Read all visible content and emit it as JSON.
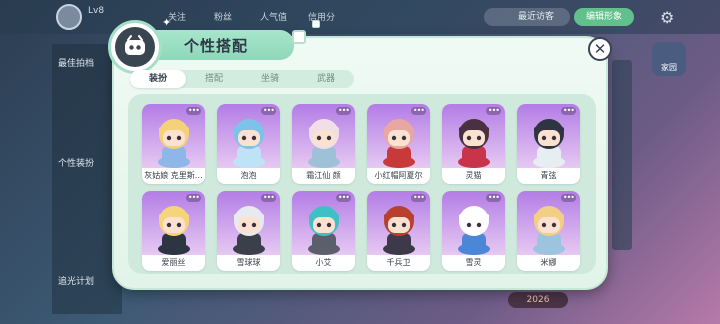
{
  "background": {
    "level": "Lv8",
    "tabs": [
      "关注",
      "粉丝",
      "人气值",
      "信用分"
    ],
    "recent_visitors": "最近访客",
    "edit_home": "编辑形象",
    "home_label": "家园",
    "left_labels": [
      "最佳拍档",
      "个性装扮",
      "追光计划"
    ],
    "badge_value": "2026"
  },
  "dialog": {
    "title": "个性搭配",
    "close_icon": "close-icon",
    "tabs": [
      {
        "label": "装扮",
        "active": true
      },
      {
        "label": "搭配",
        "active": false
      },
      {
        "label": "坐骑",
        "active": false
      },
      {
        "label": "武器",
        "active": false
      }
    ],
    "more_glyph": "•••",
    "outfits": [
      {
        "name": "灰姑娘 克里斯…",
        "hair": "#f3d27a",
        "outfit": "#8fb6e8",
        "skin": "#fbe1cf"
      },
      {
        "name": "泡泡",
        "hair": "#7cc3e8",
        "outfit": "#bfe3f6",
        "skin": "#fbe1cf"
      },
      {
        "name": "霜江仙 颜",
        "hair": "#f1dfe8",
        "outfit": "#9fc1d8",
        "skin": "#fbe1cf"
      },
      {
        "name": "小红帽阿夏尔",
        "hair": "#e8a7a2",
        "outfit": "#c83a3a",
        "skin": "#fbe1cf"
      },
      {
        "name": "灵猫",
        "hair": "#4a3140",
        "outfit": "#c8354a",
        "skin": "#fbe1cf"
      },
      {
        "name": "青弦",
        "hair": "#2e3442",
        "outfit": "#e6eef2",
        "skin": "#fbe1cf"
      },
      {
        "name": "爱丽丝",
        "hair": "#f6d57a",
        "outfit": "#2d3442",
        "skin": "#fbe1cf"
      },
      {
        "name": "雪球球",
        "hair": "#e9e9f0",
        "outfit": "#3b3f4a",
        "skin": "#fbe1cf"
      },
      {
        "name": "小艾",
        "hair": "#3dc1c4",
        "outfit": "#5a5f6b",
        "skin": "#fbe1cf"
      },
      {
        "name": "千兵卫",
        "hair": "#b8402f",
        "outfit": "#3c3a48",
        "skin": "#fbe1cf"
      },
      {
        "name": "雪灵",
        "hair": "#ffffff",
        "outfit": "#4b87d6",
        "skin": "#ffffff"
      },
      {
        "name": "米娜",
        "hair": "#f3cf84",
        "outfit": "#9cc4de",
        "skin": "#fbe1cf"
      }
    ]
  },
  "colors": {
    "accent_green": "#8fd7ba",
    "panel_green": "#cfeadd",
    "card_purple": "#b37de6"
  }
}
